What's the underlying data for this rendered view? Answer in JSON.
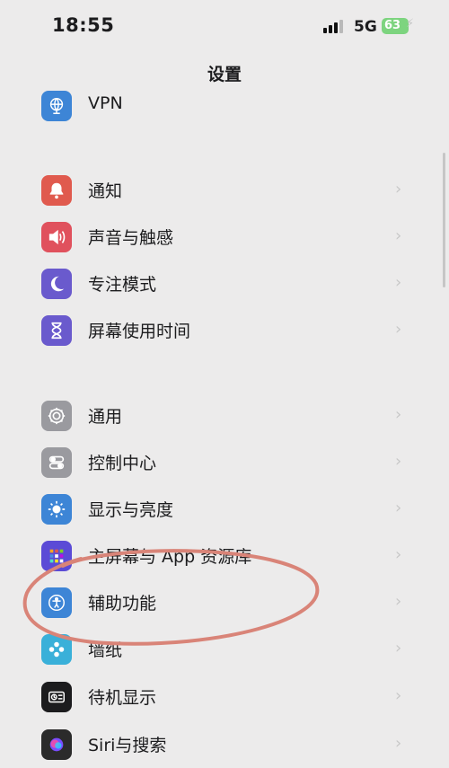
{
  "status_bar": {
    "time": "18:55",
    "network": "5G",
    "battery": "63"
  },
  "nav": {
    "title": "设置"
  },
  "rows": [
    {
      "label": "VPN",
      "icon": "vpn-globe-icon",
      "color": "#3d85d6"
    },
    {
      "label": "通知",
      "icon": "bell-icon",
      "color": "#e05a4e"
    },
    {
      "label": "声音与触感",
      "icon": "speaker-icon",
      "color": "#e0515d"
    },
    {
      "label": "专注模式",
      "icon": "moon-icon",
      "color": "#6a5acd"
    },
    {
      "label": "屏幕使用时间",
      "icon": "hourglass-icon",
      "color": "#6a5acd"
    },
    {
      "label": "通用",
      "icon": "gear-icon",
      "color": "#9a9a9f"
    },
    {
      "label": "控制中心",
      "icon": "toggles-icon",
      "color": "#9a9a9f"
    },
    {
      "label": "显示与亮度",
      "icon": "sun-icon",
      "color": "#3d85d6"
    },
    {
      "label": "主屏幕与 App 资源库",
      "icon": "app-grid-icon",
      "color": "#5b4bd6"
    },
    {
      "label": "辅助功能",
      "icon": "accessibility-icon",
      "color": "#3d85d6"
    },
    {
      "label": "墙纸",
      "icon": "flower-icon",
      "color": "#3ab0d9"
    },
    {
      "label": "待机显示",
      "icon": "standby-icon",
      "color": "#1c1c1e"
    },
    {
      "label": "Siri与搜索",
      "icon": "siri-icon",
      "color": "#2b2b2b"
    }
  ]
}
